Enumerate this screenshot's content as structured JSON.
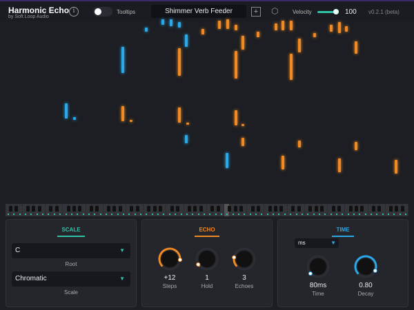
{
  "header": {
    "title": "Harmonic Echo",
    "subtitle": "by Soft Loop Audio",
    "tooltips_label": "Tooltips",
    "tooltips_on": false,
    "preset": "Shimmer Verb Feeder",
    "velocity_label": "Velocity",
    "velocity": 100,
    "version": "v0.2.1 (beta)"
  },
  "colors": {
    "scale": "#2fc4a8",
    "echo": "#f08a24",
    "time": "#2aa8e8"
  },
  "scale": {
    "title": "SCALE",
    "root_value": "C",
    "root_label": "Root",
    "scale_value": "Chromatic",
    "scale_label": "Scale"
  },
  "echo": {
    "title": "ECHO",
    "knobs": [
      {
        "value": "+12",
        "label": "Steps"
      },
      {
        "value": "1",
        "label": "Hold"
      },
      {
        "value": "3",
        "label": "Echoes"
      }
    ]
  },
  "time": {
    "title": "TIME",
    "unit": "ms",
    "knobs": [
      {
        "value": "80ms",
        "label": "Time"
      },
      {
        "value": "0.80",
        "label": "Decay"
      }
    ]
  }
}
